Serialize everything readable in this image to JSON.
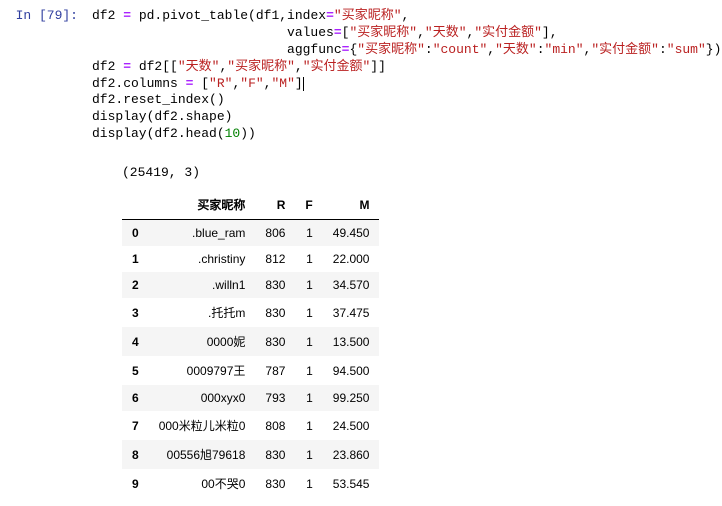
{
  "input": {
    "prompt": "In  [79]:",
    "code": {
      "l1a": "df2 ",
      "l1b": "=",
      "l1c": " pd.pivot_table(df1,index",
      "l1d": "=",
      "l1e": "\"买家昵称\"",
      "l1f": ",",
      "l2a": "                         values",
      "l2b": "=",
      "l2c": "[",
      "l2d": "\"买家昵称\"",
      "l2e": ",",
      "l2f": "\"天数\"",
      "l2g": ",",
      "l2h": "\"实付金额\"",
      "l2i": "],",
      "l3a": "                         aggfunc",
      "l3b": "=",
      "l3c": "{",
      "l3d": "\"买家昵称\"",
      "l3e": ":",
      "l3f": "\"count\"",
      "l3g": ",",
      "l3h": "\"天数\"",
      "l3i": ":",
      "l3j": "\"min\"",
      "l3k": ",",
      "l3l": "\"实付金额\"",
      "l3m": ":",
      "l3n": "\"sum\"",
      "l3o": "})",
      "l4a": "df2 ",
      "l4b": "=",
      "l4c": " df2[[",
      "l4d": "\"天数\"",
      "l4e": ",",
      "l4f": "\"买家昵称\"",
      "l4g": ",",
      "l4h": "\"实付金额\"",
      "l4i": "]]",
      "l5a": "df2.columns ",
      "l5b": "=",
      "l5c": " [",
      "l5d": "\"R\"",
      "l5e": ",",
      "l5f": "\"F\"",
      "l5g": ",",
      "l5h": "\"M\"",
      "l5i": "]",
      "l6": "df2.reset_index()",
      "l7": "display(df2.shape)",
      "l8a": "display(df2.head(",
      "l8b": "10",
      "l8c": "))"
    }
  },
  "output": {
    "shape": "(25419, 3)",
    "headers": {
      "index": "",
      "c0": "买家昵称",
      "c1": "R",
      "c2": "F",
      "c3": "M"
    },
    "rows": [
      {
        "i": "0",
        "c0": ".blue_ram",
        "c1": "806",
        "c2": "1",
        "c3": "49.450"
      },
      {
        "i": "1",
        "c0": ".christiny",
        "c1": "812",
        "c2": "1",
        "c3": "22.000"
      },
      {
        "i": "2",
        "c0": ".willn1",
        "c1": "830",
        "c2": "1",
        "c3": "34.570"
      },
      {
        "i": "3",
        "c0": ".托托m",
        "c1": "830",
        "c2": "1",
        "c3": "37.475"
      },
      {
        "i": "4",
        "c0": "0000妮",
        "c1": "830",
        "c2": "1",
        "c3": "13.500"
      },
      {
        "i": "5",
        "c0": "0009797王",
        "c1": "787",
        "c2": "1",
        "c3": "94.500"
      },
      {
        "i": "6",
        "c0": "000xyx0",
        "c1": "793",
        "c2": "1",
        "c3": "99.250"
      },
      {
        "i": "7",
        "c0": "000米粒儿米粒0",
        "c1": "808",
        "c2": "1",
        "c3": "24.500"
      },
      {
        "i": "8",
        "c0": "00556旭79618",
        "c1": "830",
        "c2": "1",
        "c3": "23.860"
      },
      {
        "i": "9",
        "c0": "00不哭0",
        "c1": "830",
        "c2": "1",
        "c3": "53.545"
      }
    ]
  }
}
